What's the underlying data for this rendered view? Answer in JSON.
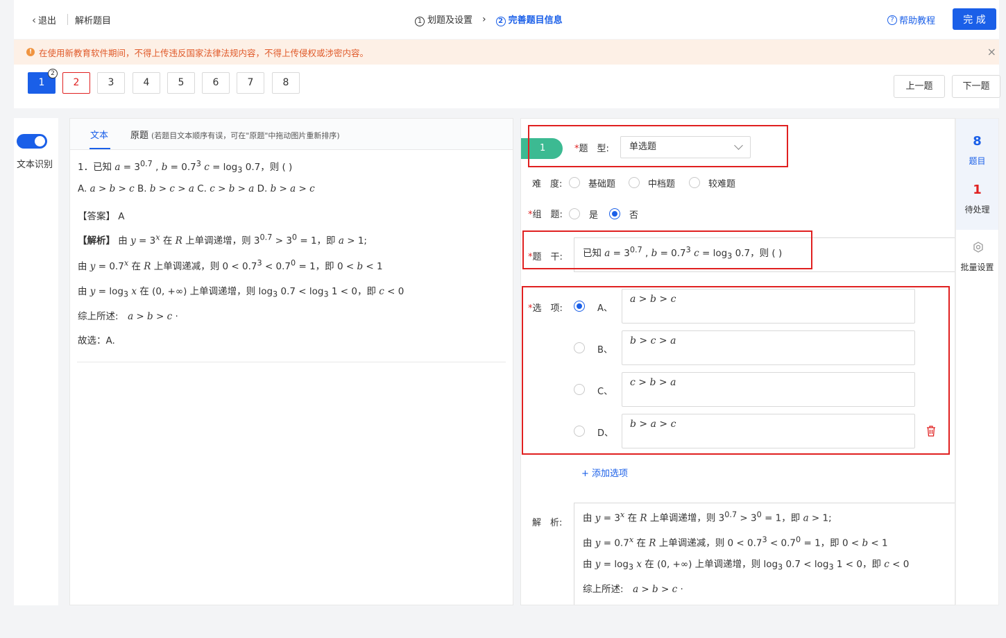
{
  "header": {
    "exit_label": "退出",
    "page_title": "解析题目",
    "step1_num": "1",
    "step1_label": "划题及设置",
    "step2_num": "2",
    "step2_label": "完善题目信息",
    "help_label": "帮助教程",
    "done_label": "完 成"
  },
  "warning": {
    "text": "在使用新教育软件期间，不得上传违反国家法律法规内容，不得上传侵权或涉密内容。"
  },
  "question_nav": {
    "numbers": [
      "1",
      "2",
      "3",
      "4",
      "5",
      "6",
      "7",
      "8"
    ],
    "badge": "2",
    "prev_label": "上一题",
    "next_label": "下一题"
  },
  "toggle": {
    "label": "文本识别"
  },
  "source": {
    "tab_text": "文本",
    "tab_original": "原题",
    "tab_note": "(若题目文本顺序有误，可在\"原题\"中拖动图片重新排序)"
  },
  "edit": {
    "tag": "1",
    "type_label": "题　型:",
    "type_value": "单选题",
    "difficulty_label": "难　度:",
    "difficulty_options": [
      "基础题",
      "中档题",
      "较难题"
    ],
    "group_label": "组　题:",
    "group_options": [
      "是",
      "否"
    ],
    "stem_label": "题　干:",
    "options_label": "选　项:",
    "option_letters": [
      "A、",
      "B、",
      "C、",
      "D、"
    ],
    "add_option": "+ 添加选项",
    "analysis_label": "解　析:"
  },
  "sidebar": {
    "total_count": "8",
    "total_label": "题目",
    "pending_count": "1",
    "pending_label": "待处理",
    "batch_label": "批量设置"
  },
  "colors": {
    "primary": "#1a5fe8",
    "error": "#e02020",
    "tag_green": "#3cba92",
    "warning_text": "#e05a2a"
  }
}
